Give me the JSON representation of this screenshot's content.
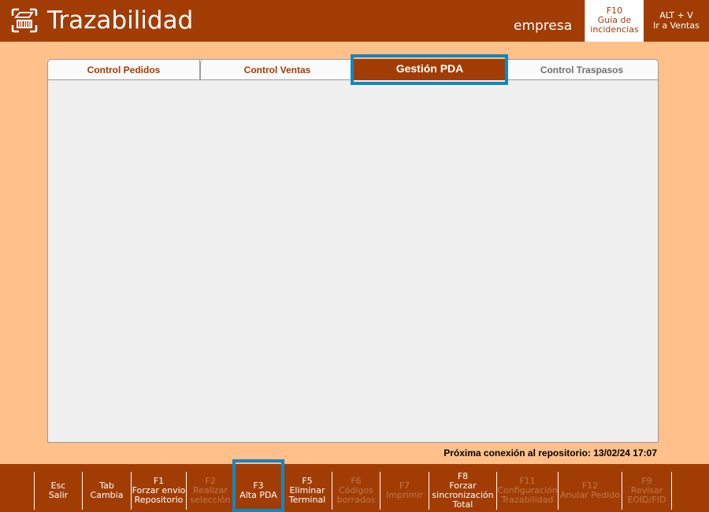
{
  "header": {
    "title": "Trazabilidad",
    "company": "empresa",
    "help_button": {
      "key": "F10",
      "line1": "Guia de",
      "line2": "incidencias"
    },
    "switch_button": {
      "key": "ALT + V",
      "line1": "Ir a Ventas"
    }
  },
  "tabs": [
    {
      "label": "Control Pedidos",
      "active": false
    },
    {
      "label": "Control Ventas",
      "active": false
    },
    {
      "label": "Gestión PDA",
      "active": true
    },
    {
      "label": "Control Traspasos",
      "active": false
    }
  ],
  "status": {
    "next_connection": "Próxima conexión al repositorio: 13/02/24 17:07"
  },
  "function_keys": [
    {
      "key": "Esc",
      "lines": [
        "Salir"
      ],
      "enabled": true
    },
    {
      "key": "Tab",
      "lines": [
        "Cambia"
      ],
      "enabled": true
    },
    {
      "key": "F1",
      "lines": [
        "Forzar envio",
        "Repositorio"
      ],
      "enabled": true
    },
    {
      "key": "F2",
      "lines": [
        "Realizar",
        "selección"
      ],
      "enabled": false
    },
    {
      "key": "F3",
      "lines": [
        "Alta PDA"
      ],
      "enabled": true
    },
    {
      "key": "F5",
      "lines": [
        "Eliminar",
        "Terminal"
      ],
      "enabled": true
    },
    {
      "key": "F6",
      "lines": [
        "Códigos",
        "borrados"
      ],
      "enabled": false
    },
    {
      "key": "F7",
      "lines": [
        "Imprimir"
      ],
      "enabled": false
    },
    {
      "key": "F8",
      "lines": [
        "Forzar",
        "sincronización",
        "Total"
      ],
      "enabled": true
    },
    {
      "key": "F11",
      "lines": [
        "Configuración",
        "Trazabilidad"
      ],
      "enabled": false
    },
    {
      "key": "F12",
      "lines": [
        "Anular Pedido"
      ],
      "enabled": false
    },
    {
      "key": "F9",
      "lines": [
        "Revisar",
        "EOID/FID"
      ],
      "enabled": false
    }
  ],
  "colors": {
    "brand": "#a13d04",
    "background": "#ffc08a",
    "highlight": "#1386c2",
    "disabled_text": "#c1764f"
  }
}
